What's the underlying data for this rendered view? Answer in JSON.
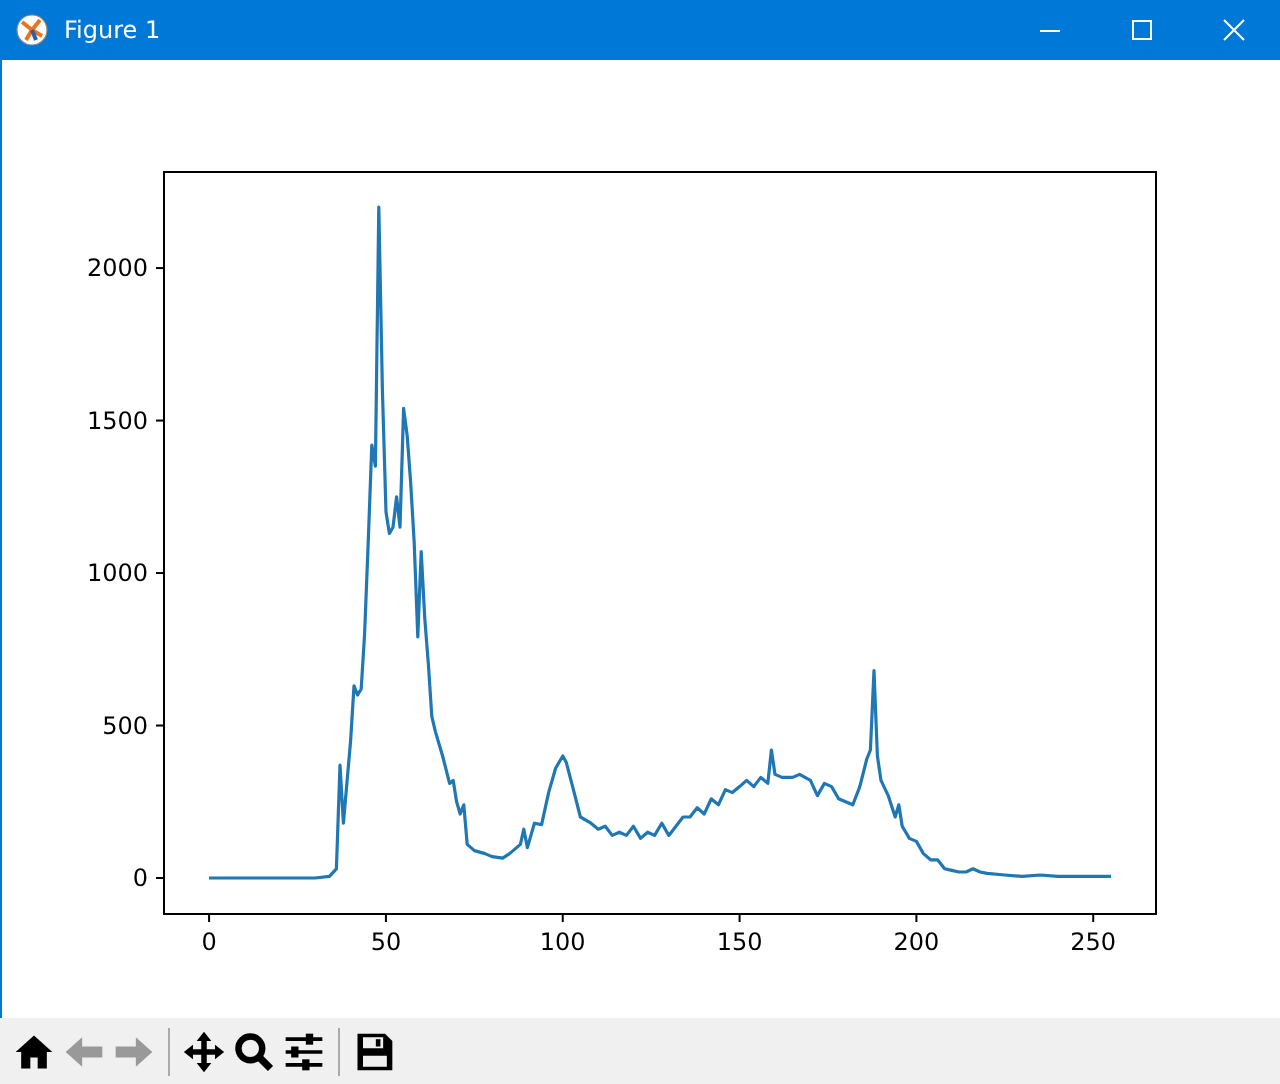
{
  "window": {
    "title": "Figure 1"
  },
  "figure": {
    "chart_data": {
      "type": "line",
      "xlim": [
        -12.75,
        267.75
      ],
      "ylim": [
        -118,
        2315
      ],
      "xticks": [
        0,
        50,
        100,
        150,
        200,
        250
      ],
      "yticks": [
        0,
        500,
        1000,
        1500,
        2000
      ],
      "x": [
        0,
        10,
        20,
        30,
        34,
        36,
        37,
        38,
        40,
        41,
        42,
        43,
        44,
        45,
        46,
        47,
        48,
        49,
        50,
        51,
        52,
        53,
        54,
        55,
        56,
        57,
        58,
        59,
        60,
        61,
        62,
        63,
        64,
        66,
        68,
        69,
        70,
        71,
        72,
        73,
        75,
        78,
        80,
        83,
        85,
        88,
        89,
        90,
        92,
        94,
        96,
        98,
        100,
        101,
        103,
        105,
        108,
        110,
        112,
        114,
        116,
        118,
        120,
        122,
        124,
        126,
        128,
        130,
        132,
        134,
        136,
        138,
        140,
        142,
        144,
        146,
        148,
        150,
        152,
        154,
        156,
        158,
        159,
        160,
        162,
        165,
        167,
        170,
        172,
        174,
        176,
        178,
        180,
        182,
        184,
        186,
        187,
        188,
        189,
        190,
        192,
        194,
        195,
        196,
        198,
        200,
        202,
        204,
        206,
        208,
        210,
        212,
        214,
        216,
        218,
        220,
        225,
        230,
        235,
        240,
        245,
        250,
        255
      ],
      "series": [
        {
          "color": "#1f77b4",
          "values": [
            0,
            0,
            0,
            0,
            5,
            30,
            370,
            180,
            450,
            630,
            600,
            620,
            800,
            1100,
            1420,
            1350,
            2200,
            1600,
            1200,
            1130,
            1150,
            1250,
            1150,
            1540,
            1450,
            1300,
            1100,
            790,
            1070,
            850,
            700,
            530,
            480,
            400,
            310,
            320,
            250,
            210,
            240,
            110,
            90,
            80,
            70,
            65,
            80,
            110,
            160,
            100,
            180,
            175,
            280,
            360,
            400,
            380,
            290,
            200,
            180,
            160,
            170,
            140,
            150,
            140,
            170,
            130,
            150,
            140,
            180,
            140,
            170,
            200,
            200,
            230,
            210,
            260,
            240,
            290,
            280,
            300,
            320,
            300,
            330,
            310,
            420,
            340,
            330,
            330,
            340,
            320,
            270,
            310,
            300,
            260,
            250,
            240,
            300,
            390,
            420,
            680,
            400,
            320,
            270,
            200,
            240,
            170,
            130,
            120,
            80,
            60,
            60,
            30,
            25,
            20,
            20,
            30,
            20,
            15,
            10,
            5,
            10,
            5,
            5,
            5,
            5
          ]
        }
      ]
    }
  },
  "toolbar": {
    "buttons": [
      {
        "kind": "home",
        "disabled": false
      },
      {
        "kind": "back",
        "disabled": true
      },
      {
        "kind": "forward",
        "disabled": true
      },
      {
        "kind": "sep"
      },
      {
        "kind": "pan",
        "disabled": false
      },
      {
        "kind": "zoom",
        "disabled": false
      },
      {
        "kind": "subplots",
        "disabled": false
      },
      {
        "kind": "sep"
      },
      {
        "kind": "save",
        "disabled": false
      }
    ]
  }
}
